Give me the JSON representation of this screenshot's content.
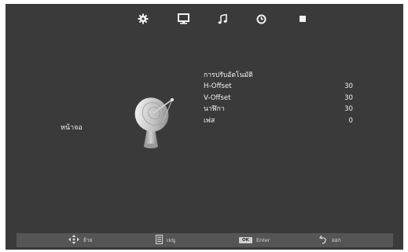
{
  "menu": {
    "tabs": [
      {
        "icon": "gear-icon"
      },
      {
        "icon": "monitor-icon",
        "active": true
      },
      {
        "icon": "music-note-icon"
      },
      {
        "icon": "clock-icon"
      },
      {
        "icon": "square-icon"
      }
    ]
  },
  "section_label": "หน้าจอ",
  "settings": {
    "title": "การปรับอัตโนมัติ",
    "rows": [
      {
        "label": "H-Offset",
        "value": "30"
      },
      {
        "label": "V-Offset",
        "value": "30"
      },
      {
        "label": "นาฬิกา",
        "value": "30"
      },
      {
        "label": "เฟส",
        "value": "0"
      }
    ]
  },
  "footer": {
    "move_label": "ย้าย",
    "menu_label": "เมนู",
    "ok_key": "OK",
    "enter_label": "Enter",
    "exit_label": "ออก"
  },
  "colors": {
    "background": "#3a3a3a",
    "footer": "#555555",
    "text": "#f2f2f2"
  }
}
